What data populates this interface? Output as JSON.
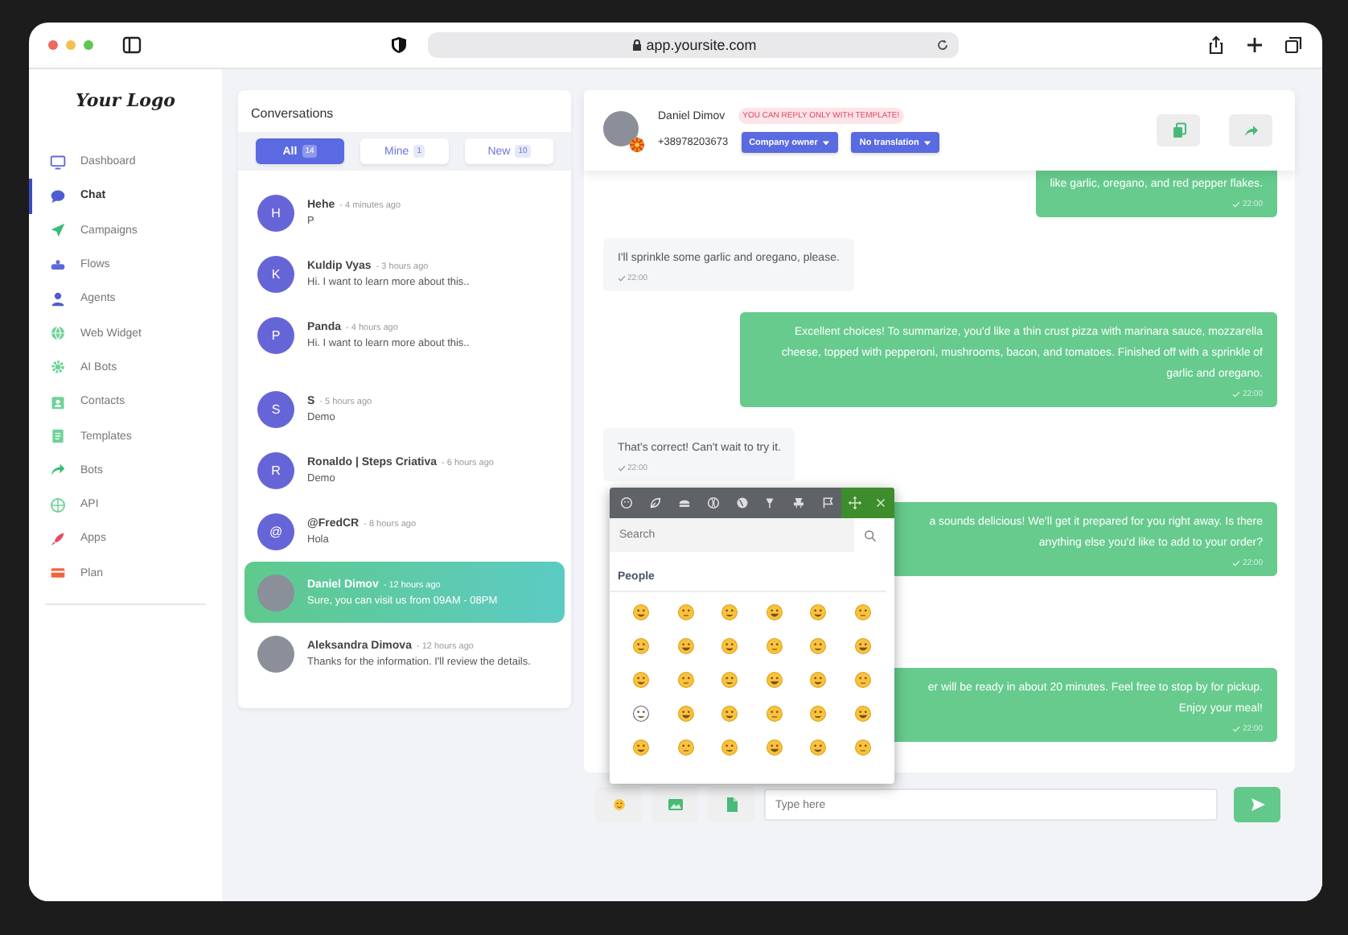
{
  "browser": {
    "url": "app.yoursite.com"
  },
  "sidebar": {
    "logo": "Your Logo",
    "items": [
      {
        "label": "Dashboard",
        "selected": false
      },
      {
        "label": "Chat",
        "selected": true
      },
      {
        "label": "Campaigns",
        "selected": false
      },
      {
        "label": "Flows",
        "selected": false
      },
      {
        "label": "Agents",
        "selected": false
      },
      {
        "label": "Web Widget",
        "selected": false
      },
      {
        "label": "AI Bots",
        "selected": false
      },
      {
        "label": "Contacts",
        "selected": false
      },
      {
        "label": "Templates",
        "selected": false
      },
      {
        "label": "Bots",
        "selected": false
      },
      {
        "label": "API",
        "selected": false
      },
      {
        "label": "Apps",
        "selected": false
      },
      {
        "label": "Plan",
        "selected": false
      }
    ]
  },
  "conversations": {
    "title": "Conversations",
    "filters": [
      {
        "label": "All",
        "count": "14",
        "selected": true
      },
      {
        "label": "Mine",
        "count": "1",
        "selected": false
      },
      {
        "label": "New",
        "count": "10",
        "selected": false
      }
    ],
    "items": [
      {
        "kind": "letter",
        "initial": "H",
        "name": "Hehe",
        "time": "- 4 minutes ago",
        "message": "P",
        "selected": false
      },
      {
        "kind": "letter",
        "initial": "K",
        "name": "Kuldip Vyas",
        "time": "- 3 hours ago",
        "message": "Hi. I want to learn more about this..",
        "selected": false
      },
      {
        "kind": "letter",
        "initial": "P",
        "name": "Panda",
        "time": "- 4 hours ago",
        "message": "Hi. I want to learn more about this..",
        "selected": false
      },
      {
        "kind": "letter",
        "initial": "S",
        "name": "S",
        "time": "- 5 hours ago",
        "message": "Demo",
        "selected": false
      },
      {
        "kind": "letter",
        "initial": "R",
        "name": "Ronaldo | Steps Criativa",
        "time": "- 6 hours ago",
        "message": "Demo",
        "selected": false
      },
      {
        "kind": "letter",
        "initial": "@",
        "name": "@FredCR",
        "time": "- 8 hours ago",
        "message": "Hola",
        "selected": false
      },
      {
        "kind": "photo",
        "name": "Daniel Dimov",
        "time": "- 12 hours ago",
        "message": "Sure, you can visit us from 09AM - 08PM",
        "selected": true
      },
      {
        "kind": "photo",
        "name": "Aleksandra Dimova",
        "time": "- 12 hours ago",
        "message": "Thanks for the information. I'll review the details.",
        "selected": false
      }
    ]
  },
  "chat": {
    "contact": {
      "name": "Daniel Dimov",
      "notice": "YOU CAN REPLY ONLY WITH TEMPLATE!",
      "phone": "+38978203673",
      "role": "Company owner",
      "translation": "No translation"
    },
    "messages": [
      {
        "kind": "sent",
        "text": "like garlic, oregano, and red pepper flakes.",
        "time": "22:00"
      },
      {
        "kind": "received",
        "text": "I'll sprinkle some garlic and oregano, please.",
        "time": "22:00"
      },
      {
        "kind": "sent",
        "text": "Excellent choices! To summarize, you'd like a thin crust pizza with marinara sauce, mozzarella cheese, topped with pepperoni, mushrooms, bacon, and tomatoes. Finished off with a sprinkle of garlic and oregano.",
        "time": "22:00"
      },
      {
        "kind": "received",
        "text": "That's correct! Can't wait to try it.",
        "time": "22:00"
      },
      {
        "kind": "sent",
        "text": "a sounds delicious! We'll get it prepared for you right away. Is there anything else you'd like to add to your order?",
        "time": "22:00"
      },
      {
        "kind": "sent",
        "text": "er will be ready in about 20 minutes. Feel free to stop by for pickup. Enjoy your meal!",
        "time": "22:00"
      }
    ],
    "composer": {
      "placeholder": "Type here"
    },
    "emoji_picker": {
      "search_placeholder": "Search",
      "category": "People"
    }
  }
}
